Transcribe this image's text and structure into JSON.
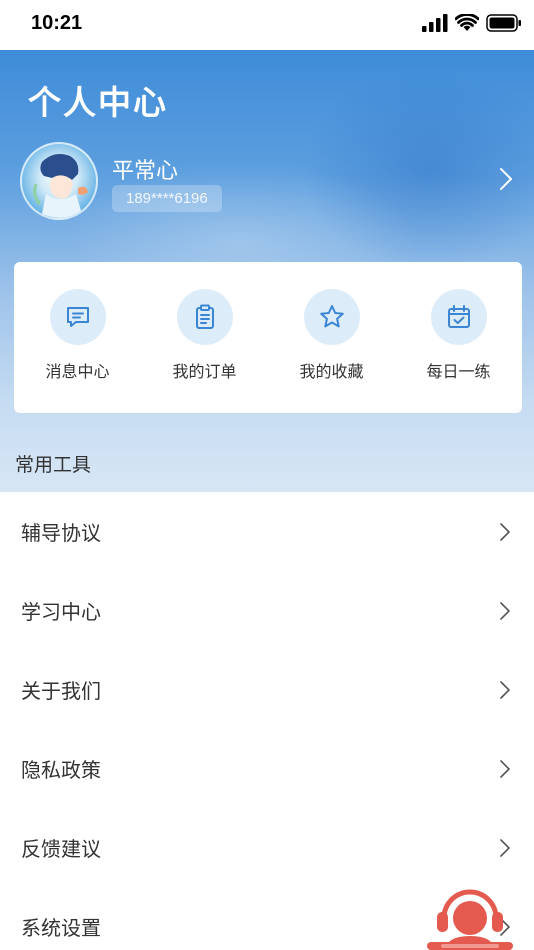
{
  "status_bar": {
    "time": "10:21"
  },
  "header": {
    "title": "个人中心"
  },
  "profile": {
    "name": "平常心",
    "phone": "189****6196"
  },
  "quick_actions": [
    {
      "label": "消息中心",
      "icon": "message-icon"
    },
    {
      "label": "我的订单",
      "icon": "clipboard-icon"
    },
    {
      "label": "我的收藏",
      "icon": "star-icon"
    },
    {
      "label": "每日一练",
      "icon": "calendar-check-icon"
    }
  ],
  "tools": {
    "title": "常用工具",
    "items": [
      {
        "label": "辅导协议"
      },
      {
        "label": "学习中心"
      },
      {
        "label": "关于我们"
      },
      {
        "label": "隐私政策"
      },
      {
        "label": "反馈建议"
      },
      {
        "label": "系统设置"
      }
    ]
  },
  "colors": {
    "accent": "#3e8cd8",
    "icon_bg": "#ddecf9",
    "icon_stroke": "#3b86d4",
    "float_button": "#e55a4e"
  }
}
